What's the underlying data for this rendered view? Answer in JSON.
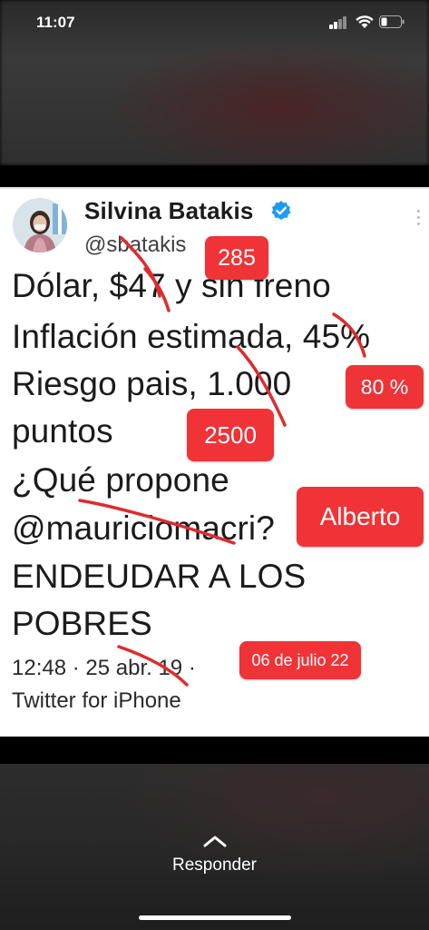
{
  "status_bar": {
    "time": "11:07"
  },
  "tweet": {
    "display_name": "Silvina Batakis",
    "handle": "@sbatakis",
    "lines": [
      "Dólar, $47 y sin freno",
      "Inflación estimada, 45%",
      "Riesgo pais, 1.000",
      "puntos",
      "¿Qué propone",
      "@mauriciomacri?",
      "ENDEUDAR A LOS",
      "POBRES"
    ],
    "timestamp": "12:48 · 25 abr. 19 ·",
    "source": "Twitter for iPhone"
  },
  "annotations": {
    "sticker_285": "285",
    "sticker_80": "80 %",
    "sticker_2500": "2500",
    "sticker_alberto": "Alberto",
    "sticker_date": "06 de julio 22",
    "color": "#ef3337"
  },
  "footer": {
    "reply_label": "Responder"
  }
}
